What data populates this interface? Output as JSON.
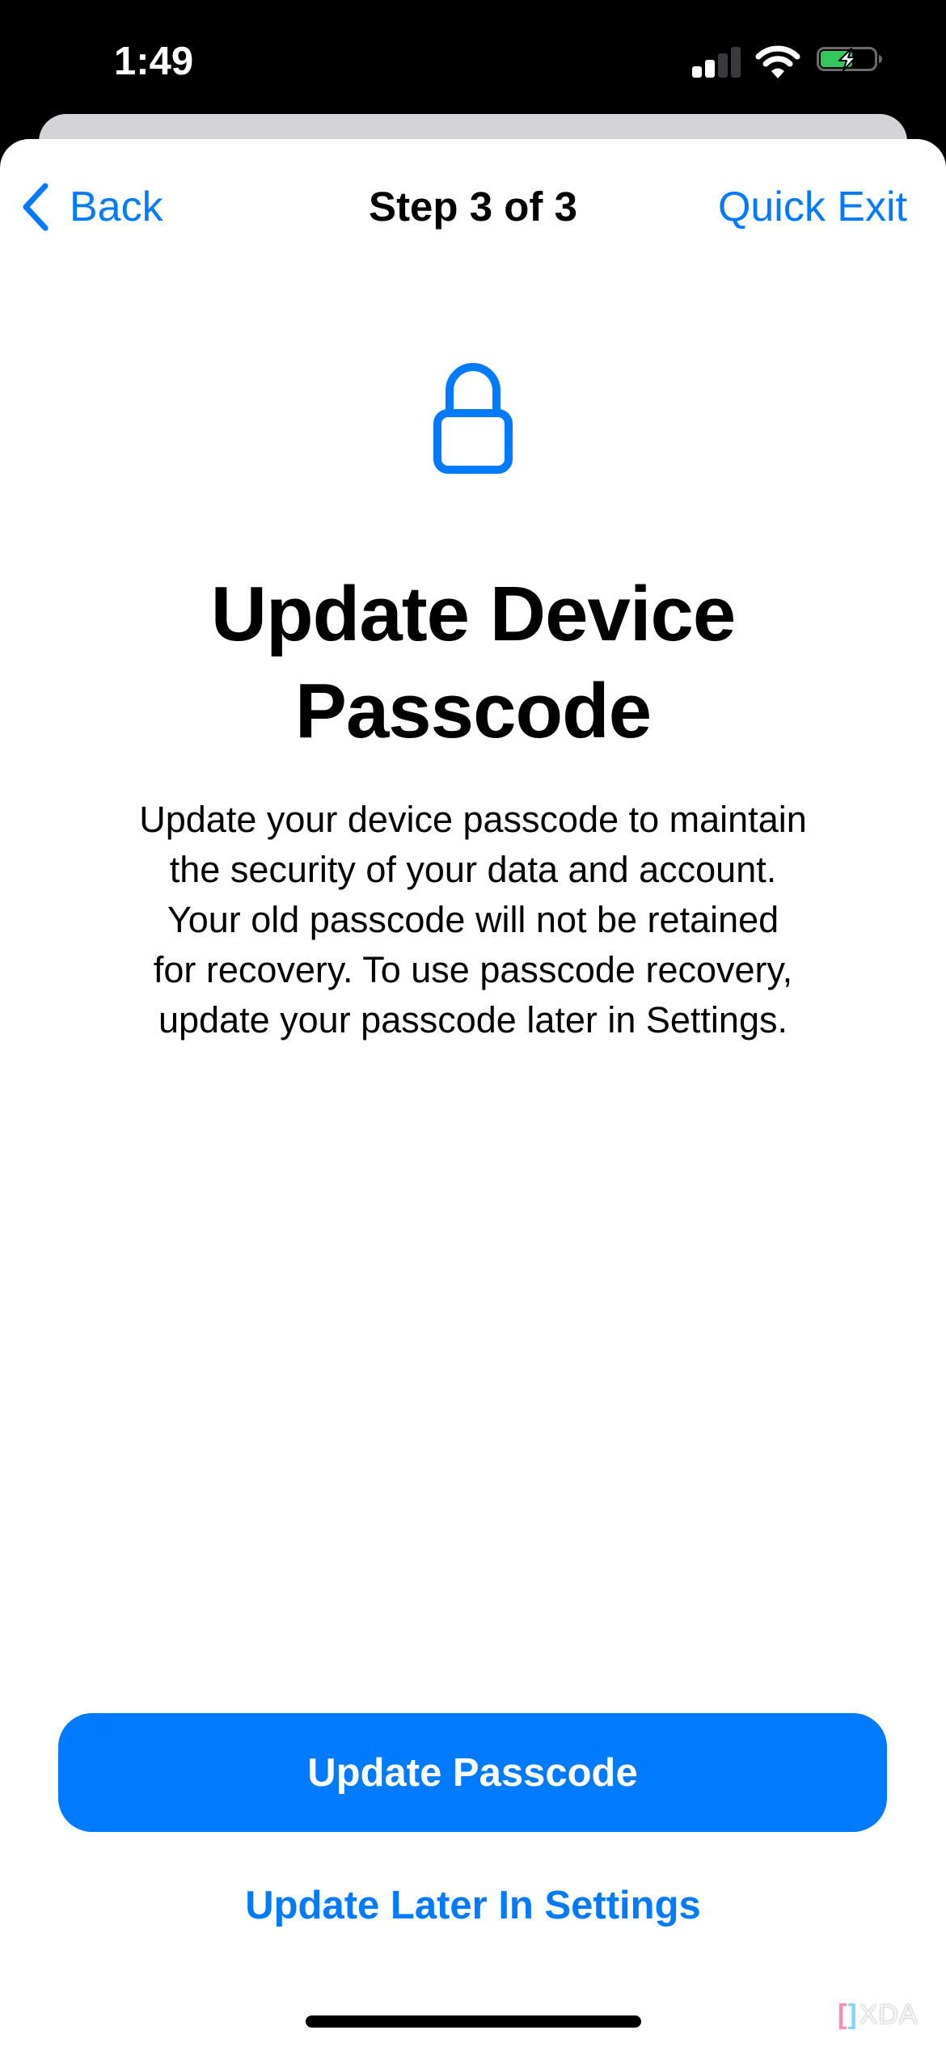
{
  "status_bar": {
    "time": "1:49",
    "signal_bars_active": 2,
    "signal_bars_total": 4,
    "wifi_icon": "wifi-icon",
    "battery_level_fraction": 0.6,
    "battery_charging": true,
    "colors": {
      "battery_fill": "#34C759"
    }
  },
  "nav": {
    "back_icon": "chevron-left-icon",
    "back_label": "Back",
    "title": "Step 3 of 3",
    "quick_exit_label": "Quick Exit"
  },
  "content": {
    "icon": "lock-icon",
    "title_lines": [
      "Update Device",
      "Passcode"
    ],
    "body_lines": [
      "Update your device passcode to maintain",
      "the security of your data and account.",
      "Your old passcode will not be retained",
      "for recovery. To use passcode recovery,",
      "update your passcode later in Settings."
    ]
  },
  "actions": {
    "primary_label": "Update Passcode",
    "secondary_label": "Update Later In Settings"
  },
  "watermark": {
    "bracket_left": "[",
    "bracket_right": "]",
    "text": "XDA"
  },
  "colors": {
    "accent": "#007AFF",
    "sheet_background": "#FFFFFF",
    "sheet_behind": "#D4D4D8",
    "status_bar_background": "#000000"
  }
}
